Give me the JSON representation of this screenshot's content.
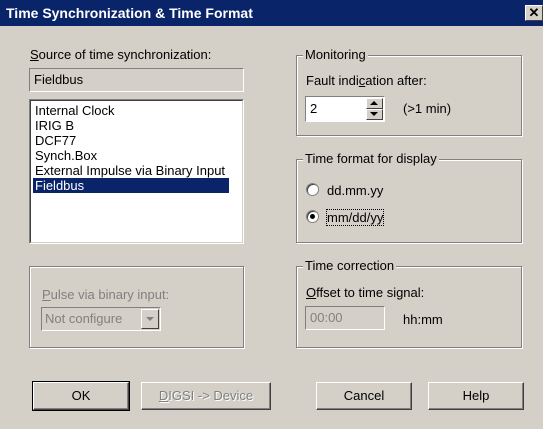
{
  "window": {
    "title": "Time Synchronization & Time Format",
    "close_glyph": "✕"
  },
  "source": {
    "label_pre": "",
    "label_mnemonic": "S",
    "label_post": "ource of time synchronization:",
    "current_value": "Fieldbus",
    "items": [
      {
        "label": "Internal Clock",
        "selected": false
      },
      {
        "label": "IRIG B",
        "selected": false
      },
      {
        "label": "DCF77",
        "selected": false
      },
      {
        "label": "Synch.Box",
        "selected": false
      },
      {
        "label": "External Impulse via Binary Input",
        "selected": false
      },
      {
        "label": "Fieldbus",
        "selected": true
      }
    ]
  },
  "pulse": {
    "label_pre": "",
    "label_mnemonic": "P",
    "label_post": "ulse via binary input:",
    "value": "Not configure",
    "dropdown_icon": "chevron-down-icon"
  },
  "monitoring": {
    "group_title": "Monitoring",
    "label_pre": "Fault indi",
    "label_mnemonic": "c",
    "label_post": "ation after:",
    "value": "2",
    "unit": "(>1 min)"
  },
  "time_format": {
    "group_title": "Time format for display",
    "options": [
      {
        "label": "dd.mm.yy",
        "checked": false
      },
      {
        "label": "mm/dd/yy",
        "checked": true
      }
    ]
  },
  "time_correction": {
    "group_title": "Time correction",
    "label_pre": "",
    "label_mnemonic": "O",
    "label_post": "ffset to time signal:",
    "value": "00:00",
    "unit": "hh:mm"
  },
  "buttons": {
    "ok": "OK",
    "digsi_mnemonic": "D",
    "digsi_rest": "IGSI -> Device",
    "cancel": "Cancel",
    "help": "Help"
  }
}
